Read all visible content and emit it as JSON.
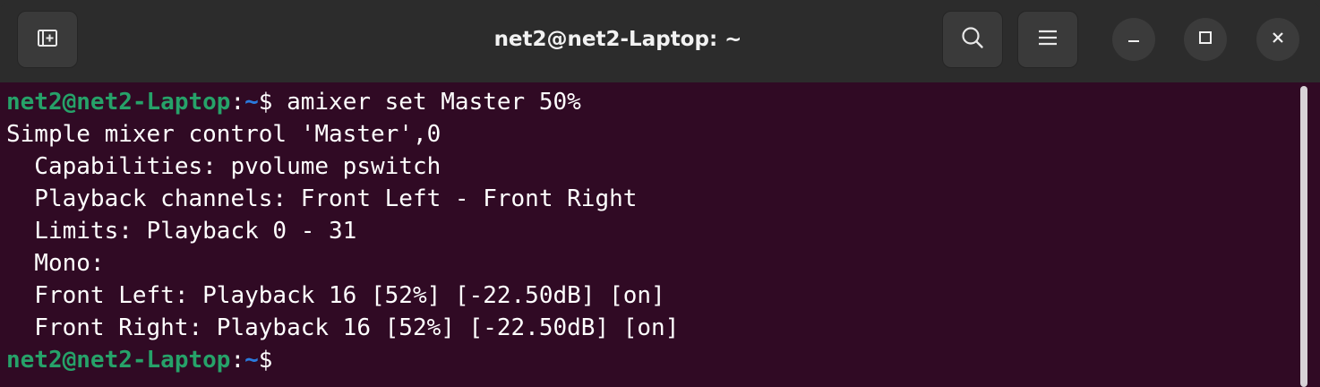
{
  "window": {
    "title": "net2@net2-Laptop: ~"
  },
  "header": {
    "new_tab_icon": "new-tab-icon",
    "search_icon": "search-icon",
    "menu_icon": "hamburger-menu-icon",
    "minimize_icon": "minimize-icon",
    "maximize_icon": "maximize-icon",
    "close_icon": "close-icon"
  },
  "terminal": {
    "prompt": {
      "user_host": "net2@net2-Laptop",
      "separator": ":",
      "cwd": "~",
      "symbol": "$"
    },
    "command": " amixer set Master 50%",
    "output": [
      "Simple mixer control 'Master',0",
      "  Capabilities: pvolume pswitch",
      "  Playback channels: Front Left - Front Right",
      "  Limits: Playback 0 - 31",
      "  Mono:",
      "  Front Left: Playback 16 [52%] [-22.50dB] [on]",
      "  Front Right: Playback 16 [52%] [-22.50dB] [on]"
    ]
  },
  "colors": {
    "terminal_bg": "#300a24",
    "header_bg": "#2c2c2c",
    "prompt_user": "#26a269",
    "prompt_cwd": "#2a7bde",
    "text": "#ffffff"
  }
}
